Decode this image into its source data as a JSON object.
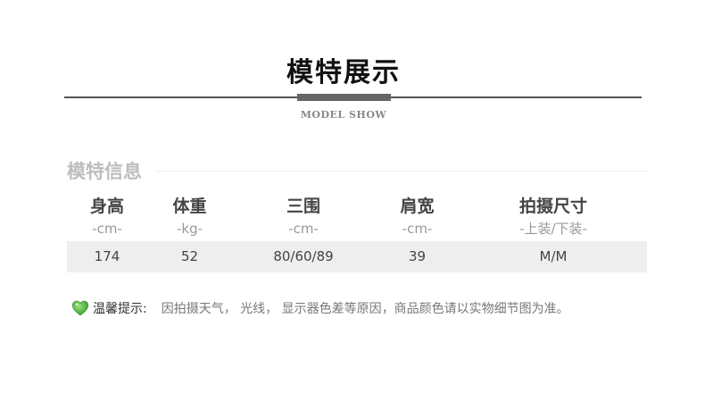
{
  "section": {
    "title": "模特展示",
    "subtitle": "MODEL SHOW"
  },
  "info": {
    "title": "模特信息",
    "headers": [
      "身高",
      "体重",
      "三围",
      "肩宽",
      "拍摄尺寸"
    ],
    "units": [
      "-cm-",
      "-kg-",
      "-cm-",
      "-cm-",
      "-上装/下装-"
    ],
    "values": [
      "174",
      "52",
      "80/60/89",
      "39",
      "M/M"
    ]
  },
  "tip": {
    "icon": "green-heart-icon",
    "icon_color": "#3db23a",
    "label": "温馨提示:",
    "text": "因拍摄天气， 光线， 显示器色差等原因，商品颜色请以实物细节图为准。"
  }
}
